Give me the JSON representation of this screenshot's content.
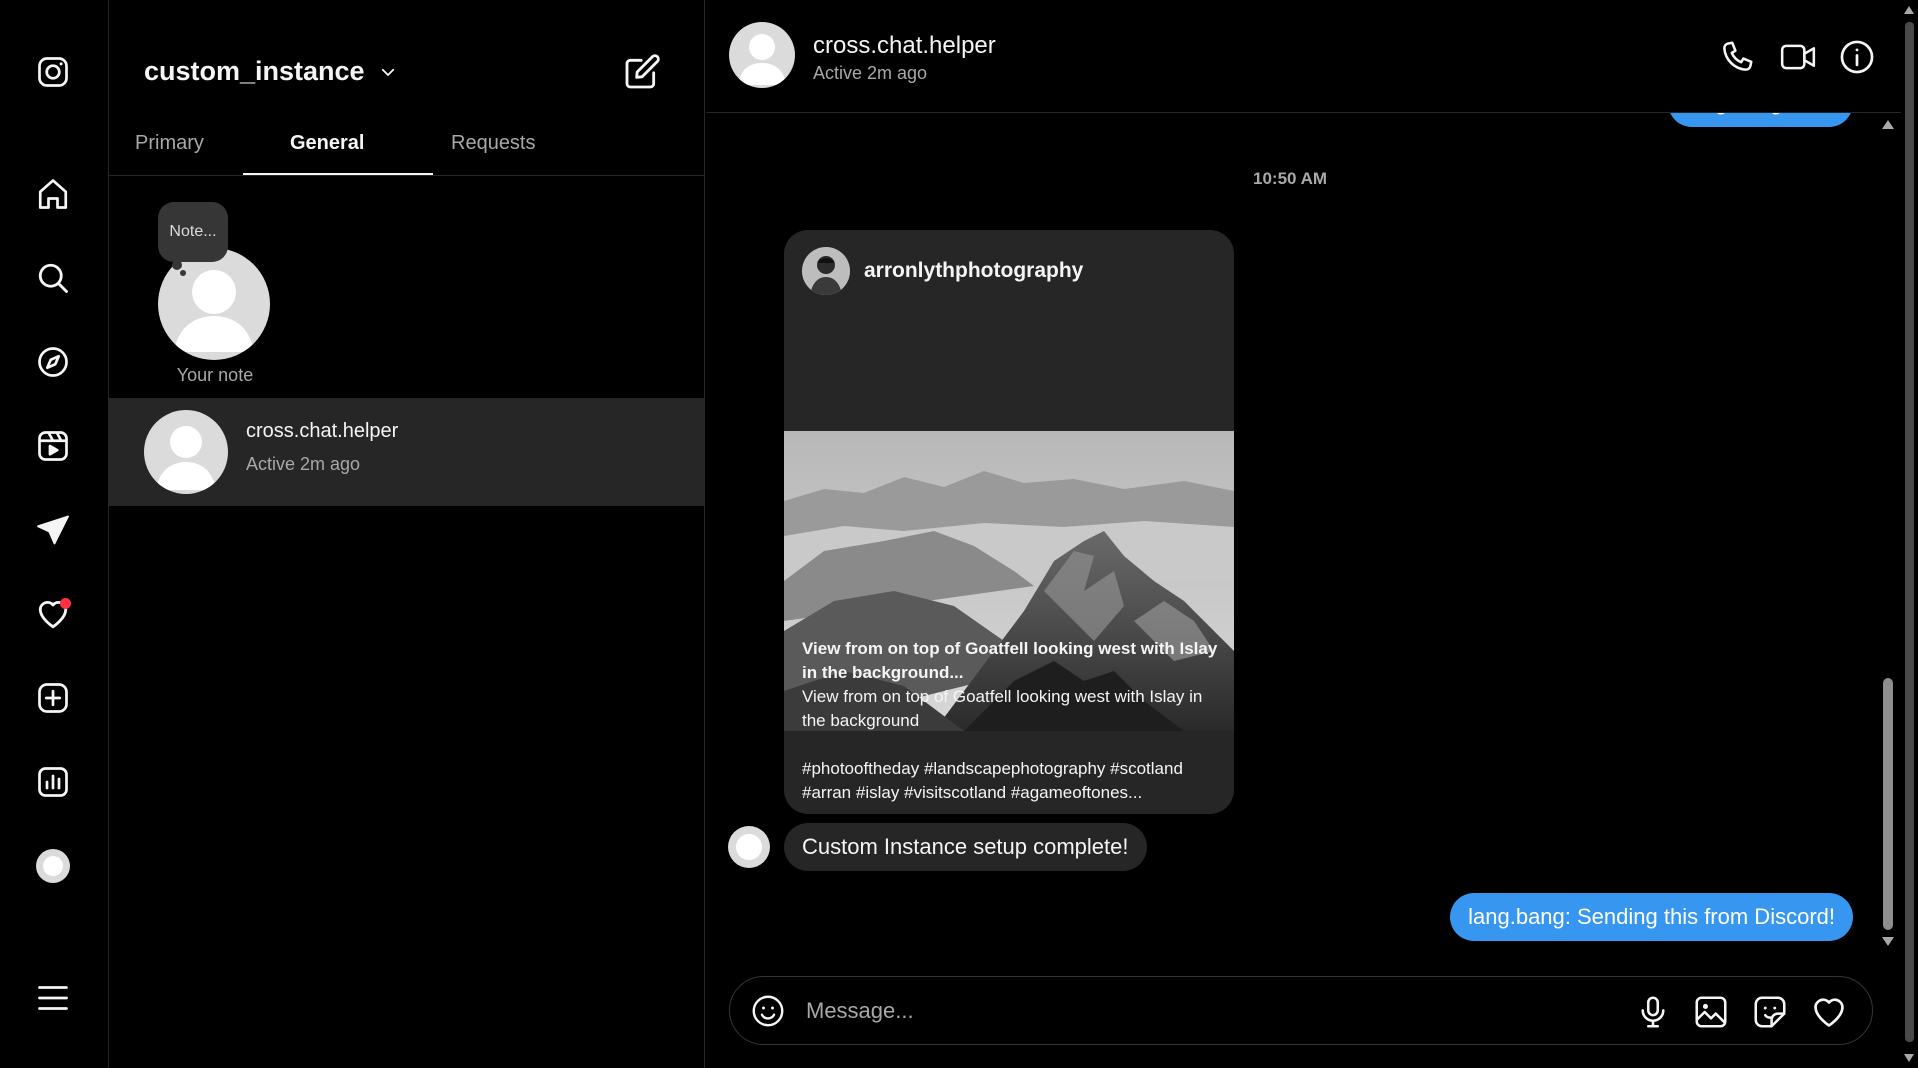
{
  "rail": {
    "items": [
      {
        "name": "instagram-logo-icon"
      },
      {
        "name": "home-icon"
      },
      {
        "name": "search-icon"
      },
      {
        "name": "explore-icon"
      },
      {
        "name": "reels-icon"
      },
      {
        "name": "messages-icon"
      },
      {
        "name": "notifications-icon"
      },
      {
        "name": "create-icon"
      },
      {
        "name": "dashboard-icon"
      },
      {
        "name": "profile-avatar"
      },
      {
        "name": "menu-icon"
      }
    ],
    "notification_dot_color": "#ff3040"
  },
  "inbox": {
    "account_name": "custom_instance",
    "tabs": [
      {
        "label": "Primary",
        "active": false
      },
      {
        "label": "General",
        "active": true
      },
      {
        "label": "Requests",
        "active": false
      }
    ],
    "note": {
      "bubble_text": "Note...",
      "caption": "Your note"
    },
    "threads": [
      {
        "name": "cross.chat.helper",
        "status": "Active 2m ago",
        "selected": true
      }
    ]
  },
  "chat": {
    "contact_name": "cross.chat.helper",
    "contact_status": "Active 2m ago",
    "messages": {
      "top_outgoing": "lang.bang: cool",
      "timestamp": "10:50 AM",
      "shared_post": {
        "username": "arronlythphotography",
        "title": "View from on top of Goatfell looking west with Islay in the background...",
        "body": "View from on top of Goatfell looking west with Islay in the background",
        "hashtags": "#photooftheday #landscapephotography #scotland #arran #islay #visitscotland #agameoftones..."
      },
      "incoming": "Custom Instance setup complete!",
      "bottom_outgoing": "lang.bang: Sending this from Discord!"
    },
    "composer": {
      "placeholder": "Message..."
    },
    "colors": {
      "outgoing_bubble": "#3797f0",
      "incoming_bubble": "#262626"
    }
  }
}
